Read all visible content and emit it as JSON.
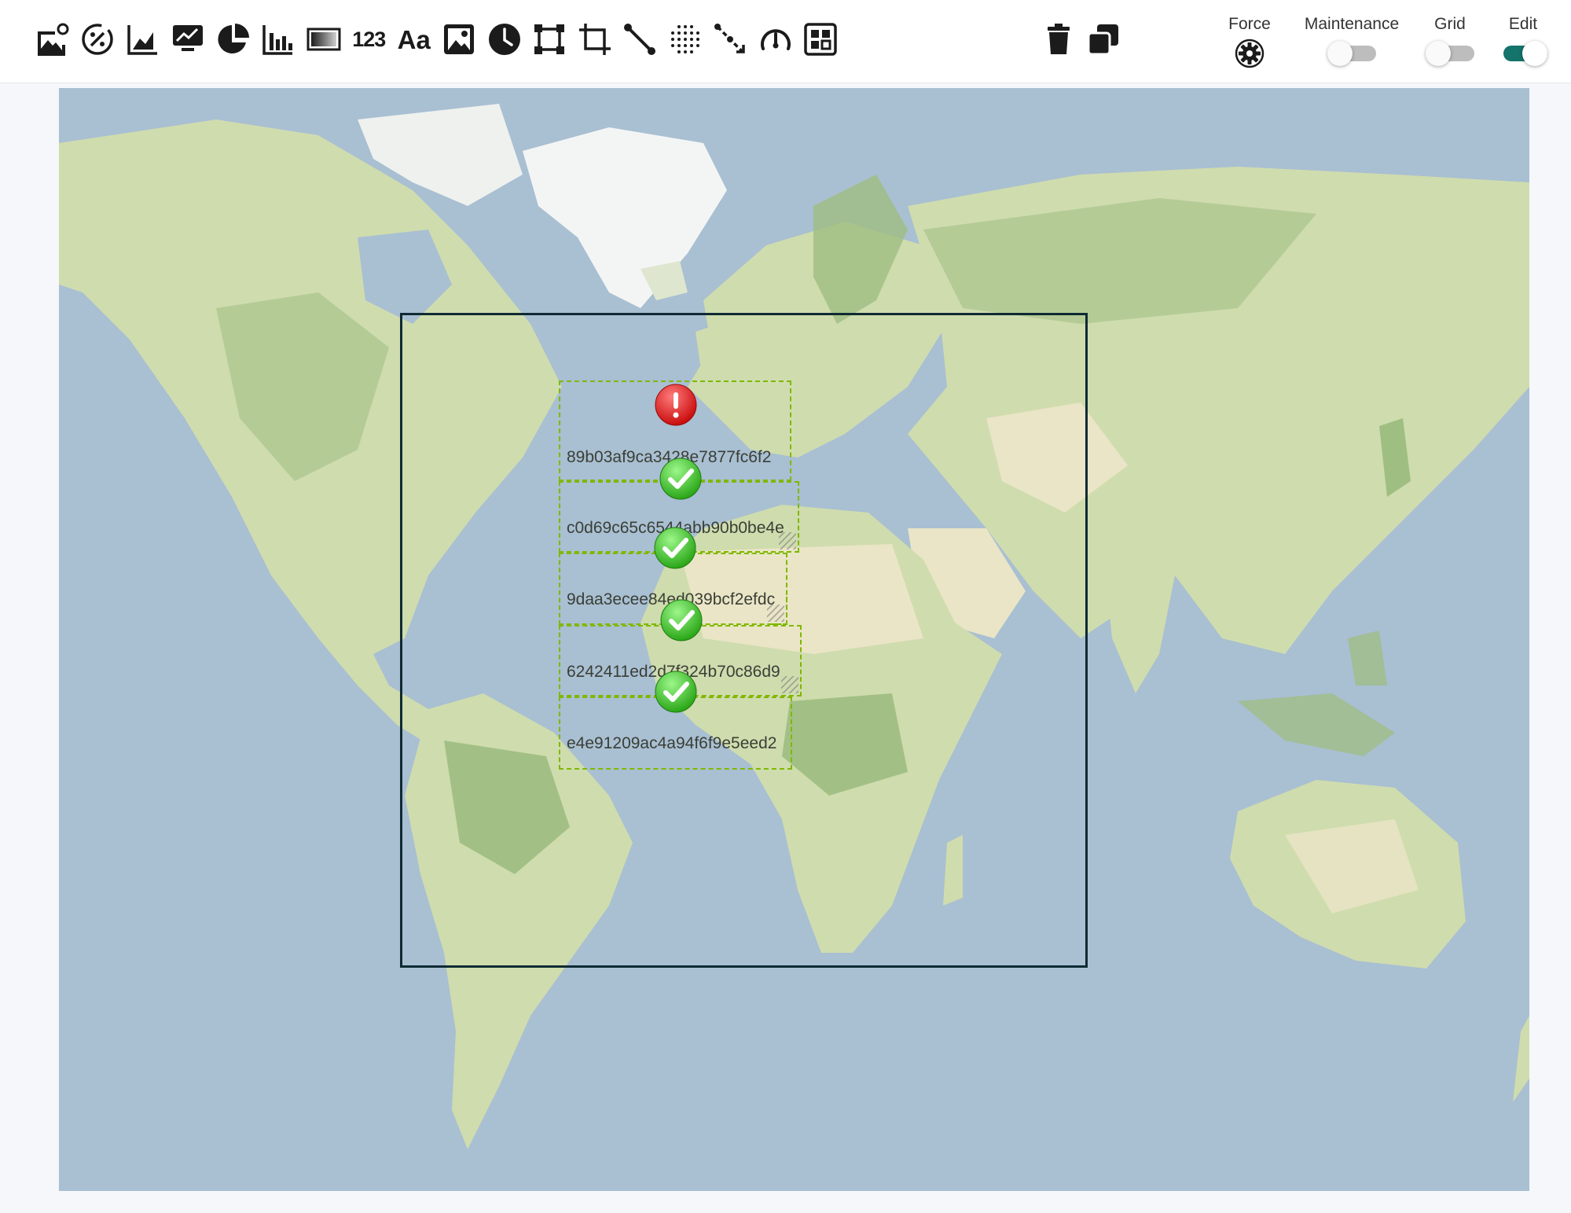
{
  "toolbar": {
    "tools": [
      {
        "name": "add-image-icon",
        "label": ""
      },
      {
        "name": "percent-gauge-icon",
        "label": ""
      },
      {
        "name": "area-chart-icon",
        "label": ""
      },
      {
        "name": "monitor-chart-icon",
        "label": ""
      },
      {
        "name": "pie-chart-icon",
        "label": ""
      },
      {
        "name": "bar-chart-icon",
        "label": ""
      },
      {
        "name": "gradient-bar-icon",
        "label": ""
      },
      {
        "name": "number-widget-icon",
        "label": "123"
      },
      {
        "name": "text-widget-icon",
        "label": "Aa"
      },
      {
        "name": "image-widget-icon",
        "label": ""
      },
      {
        "name": "clock-icon",
        "label": ""
      },
      {
        "name": "frame-icon",
        "label": ""
      },
      {
        "name": "crop-icon",
        "label": ""
      },
      {
        "name": "line-icon",
        "label": ""
      },
      {
        "name": "dot-grid-icon",
        "label": ""
      },
      {
        "name": "connector-icon",
        "label": ""
      },
      {
        "name": "speedometer-icon",
        "label": ""
      },
      {
        "name": "dashboard-grid-icon",
        "label": ""
      }
    ],
    "actions": [
      {
        "name": "trash-icon"
      },
      {
        "name": "duplicate-icon"
      }
    ],
    "force_label": "Force",
    "maintenance_label": "Maintenance",
    "grid_label": "Grid",
    "edit_label": "Edit",
    "maintenance_on": false,
    "grid_on": false,
    "edit_on": true,
    "accent_color": "#14736a"
  },
  "map": {
    "nodes": [
      {
        "id": "89b03af9ca3428e7877fc6f2",
        "status": "error"
      },
      {
        "id": "c0d69c65c6544abb90b0be4e",
        "status": "ok"
      },
      {
        "id": "9daa3ecee84ed039bcf2efdc",
        "status": "ok"
      },
      {
        "id": "6242411ed2d7f324b70c86d9",
        "status": "ok"
      },
      {
        "id": "e4e91209ac4a94f6f9e5eed2",
        "status": "ok"
      }
    ],
    "colors": {
      "ocean": "#a9bfd2",
      "land": "#cfdcae",
      "forest": "#9fbe82",
      "desert": "#eae5c6",
      "ice": "#f3f5f4",
      "node_border": "#7fb800",
      "frame_border": "#0f2a33",
      "error": "#e02020",
      "ok": "#38c21f"
    }
  }
}
